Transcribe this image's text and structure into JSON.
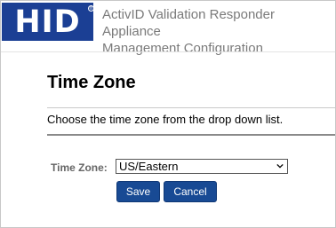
{
  "header": {
    "logo_text": "HID",
    "registered_mark": "®",
    "app_title_line1": "ActivID Validation Responder Appliance",
    "app_title_line2": "Management Configuration"
  },
  "page": {
    "title": "Time Zone",
    "instructions": "Choose the time zone from the drop down list."
  },
  "form": {
    "time_zone_label": "Time Zone:",
    "time_zone_value": "US/Eastern",
    "save_label": "Save",
    "cancel_label": "Cancel"
  },
  "colors": {
    "brand_blue": "#1b3f94",
    "button_blue": "#184a94"
  },
  "icons": {
    "dropdown": "chevron-down-icon"
  }
}
